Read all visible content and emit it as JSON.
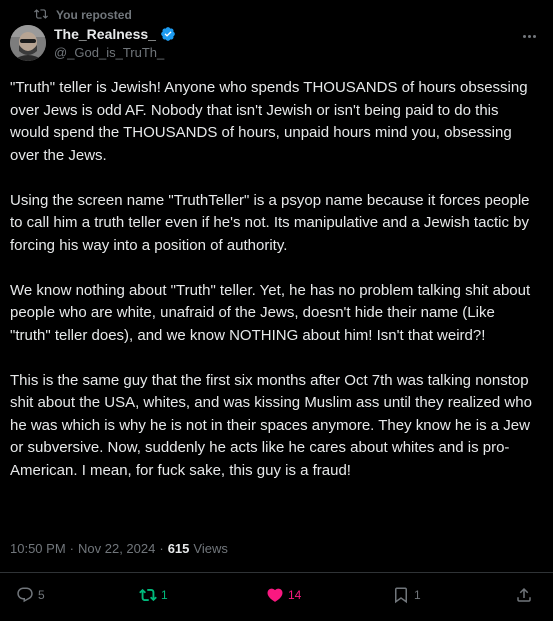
{
  "repost_label": "You reposted",
  "author": {
    "display_name": "The_Realness_",
    "handle": "@_God_is_TruTh_",
    "verified": true
  },
  "body": {
    "paragraphs": [
      "\"Truth\" teller is Jewish! Anyone who spends THOUSANDS of hours obsessing over Jews is odd AF. Nobody that isn't Jewish or isn't being paid to do this would spend the THOUSANDS of hours, unpaid hours mind you, obsessing over the Jews.",
      "Using the screen name \"TruthTeller\" is a psyop name because it forces people to call him a truth teller even if he's not. Its manipulative and a Jewish tactic by forcing his way into a position of authority.",
      "We know nothing about \"Truth\" teller. Yet, he has no problem talking shit about people who are white, unafraid of the Jews, doesn't hide their name (Like \"truth\" teller does), and we know NOTHING about him! Isn't that weird?!",
      "This is the same guy that the first six months after Oct 7th was talking nonstop shit about the USA, whites, and was kissing Muslim ass until they realized who he was which is why he is not in their spaces anymore. They know he is a Jew or subversive. Now, suddenly he acts like he cares about whites and is pro-American. I mean, for fuck sake, this guy is a fraud!"
    ]
  },
  "meta": {
    "time": "10:50 PM",
    "separator": "·",
    "date": "Nov 22, 2024",
    "views_count": "615",
    "views_label": "Views"
  },
  "actions": {
    "replies": "5",
    "reposts": "1",
    "likes": "14",
    "bookmarks": "1"
  },
  "colors": {
    "background": "#000000",
    "text": "#e7e9ea",
    "muted": "#71767b",
    "verified": "#1d9bf0",
    "repost_active": "#00ba7c",
    "like_active": "#f91880"
  },
  "icons": [
    "repost-icon",
    "verified-badge-icon",
    "more-icon",
    "reply-icon",
    "like-icon",
    "bookmark-icon",
    "share-icon"
  ]
}
